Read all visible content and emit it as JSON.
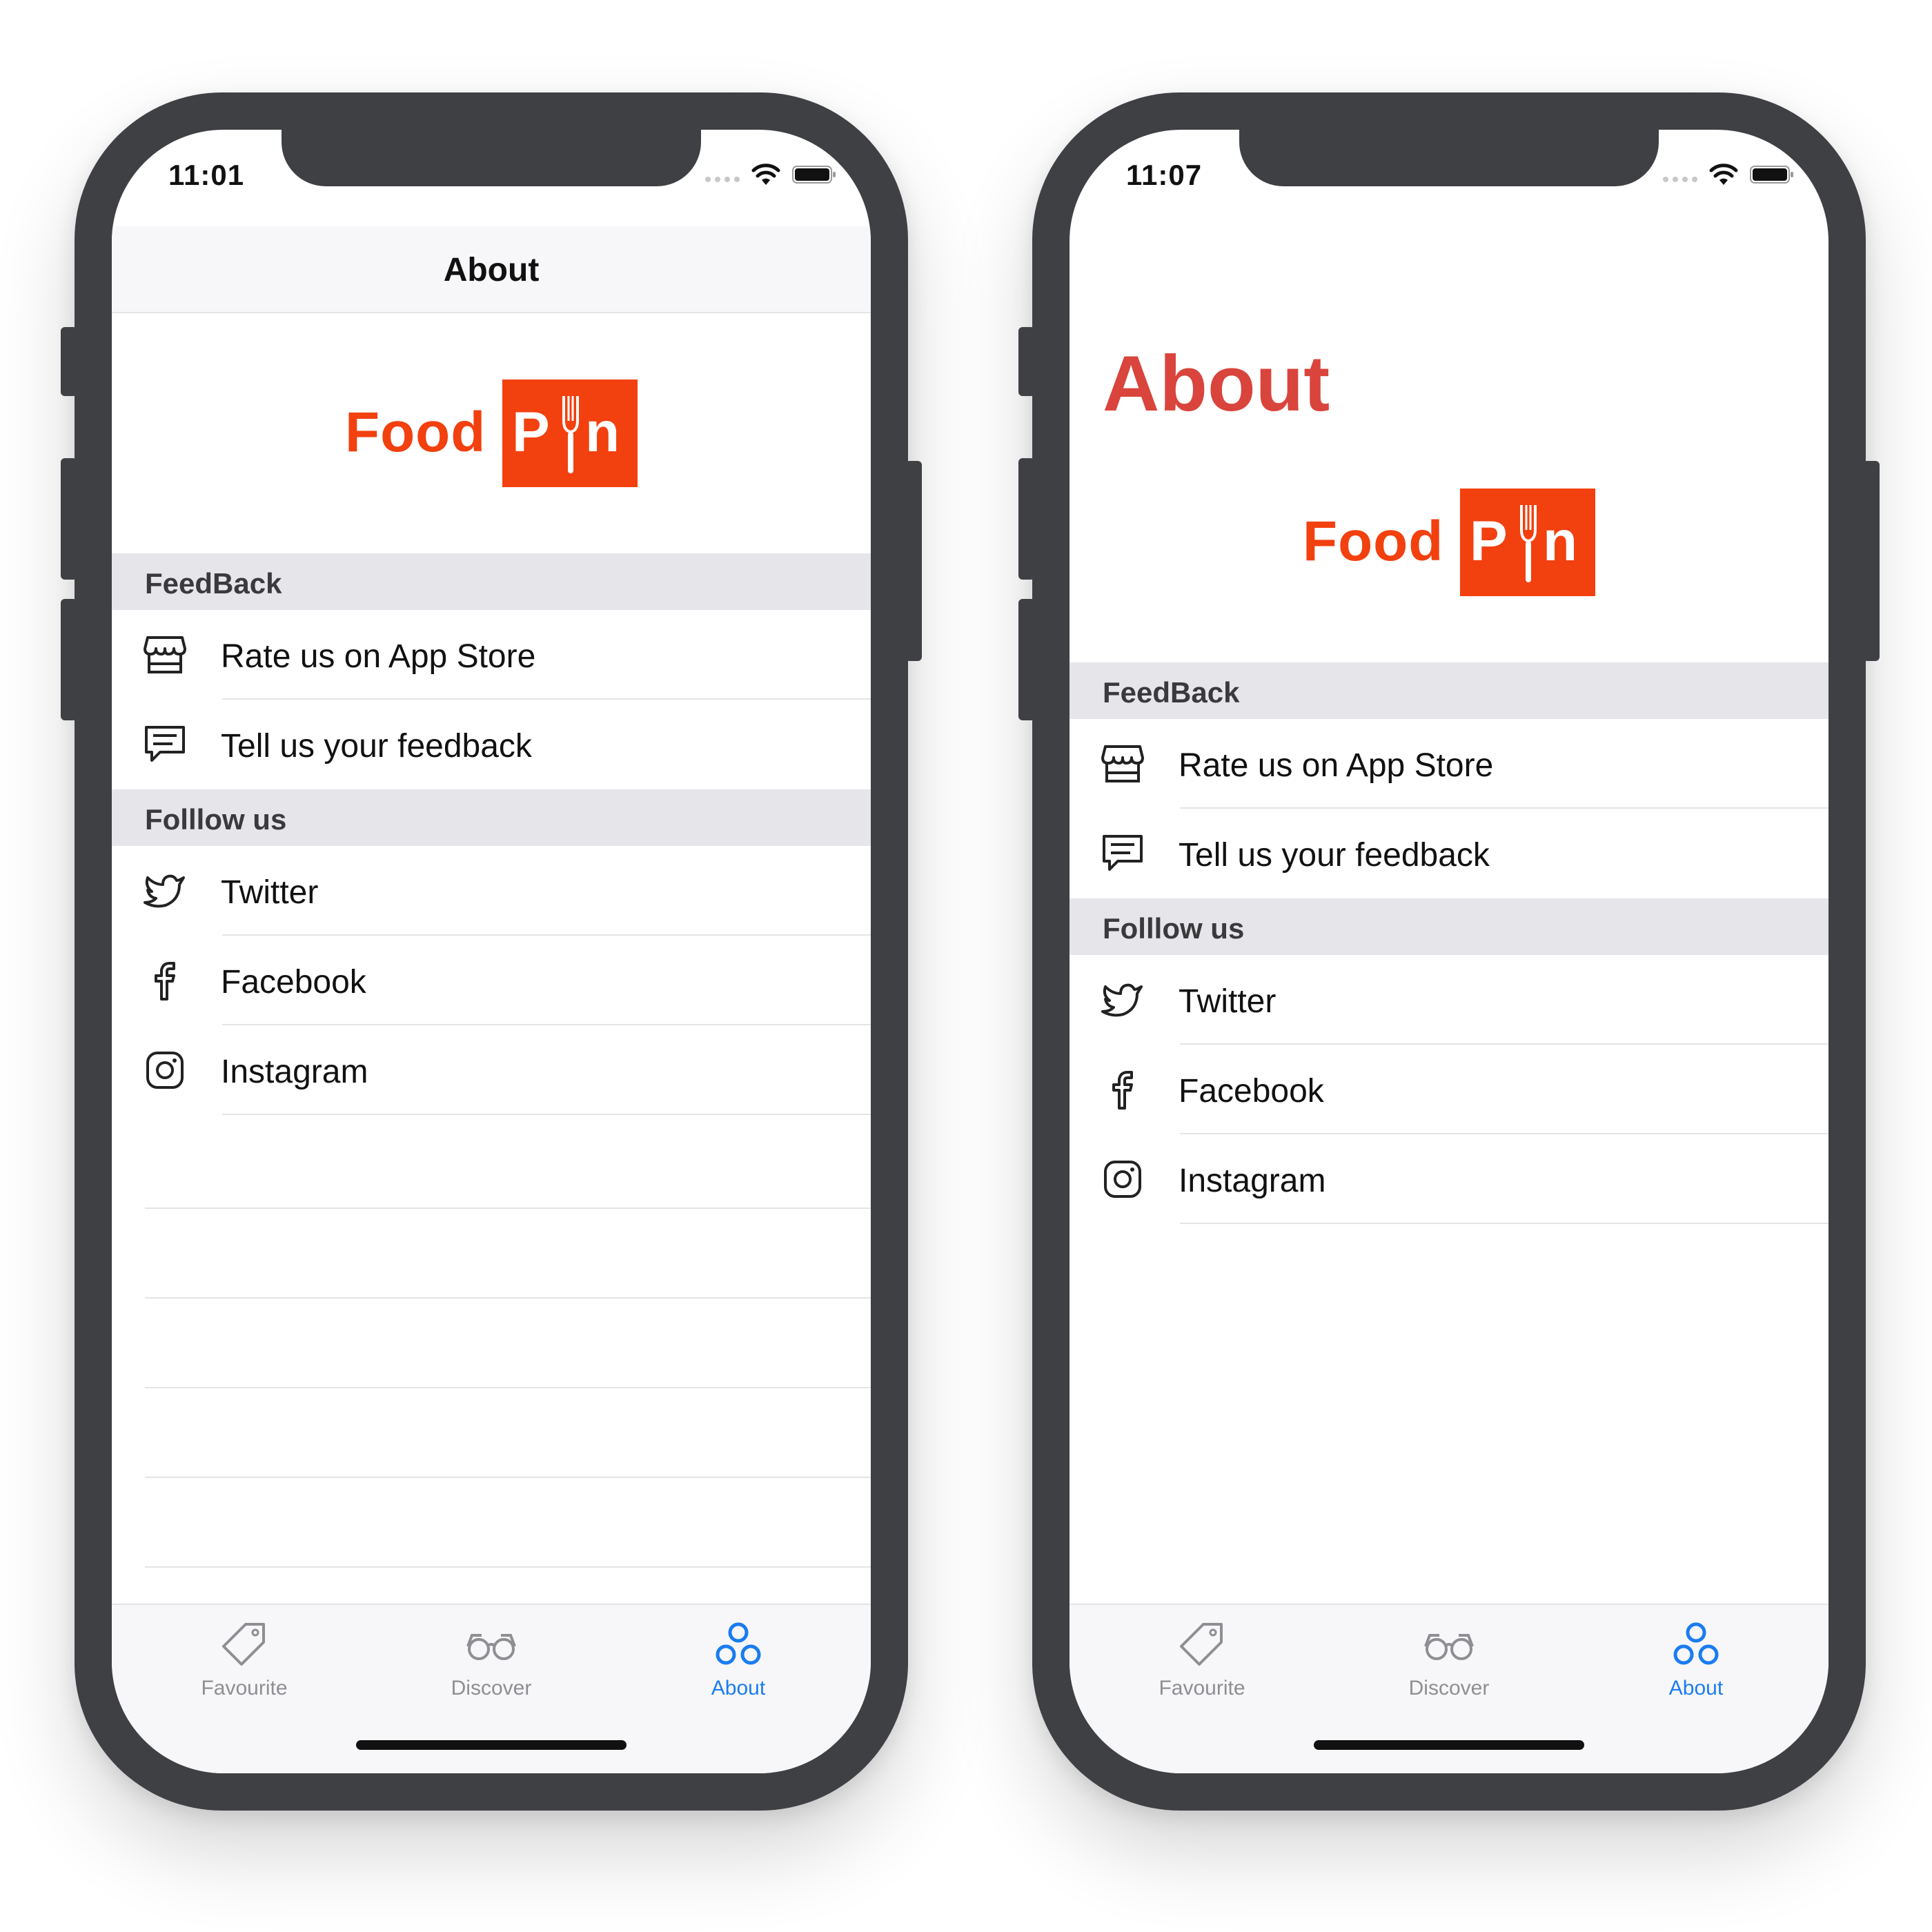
{
  "phones": [
    {
      "status_time": "11:01",
      "nav_title": "About",
      "large_title": "",
      "logo": {
        "food": "Food",
        "p": "P",
        "n": "n"
      },
      "sections": [
        {
          "header": "FeedBack",
          "rows": [
            {
              "icon": "store-icon",
              "label": "Rate us on App Store"
            },
            {
              "icon": "chat-icon",
              "label": "Tell us your feedback"
            }
          ]
        },
        {
          "header": "Folllow us",
          "rows": [
            {
              "icon": "twitter-icon",
              "label": "Twitter"
            },
            {
              "icon": "facebook-icon",
              "label": "Facebook"
            },
            {
              "icon": "instagram-icon",
              "label": "Instagram"
            }
          ]
        }
      ],
      "tabs": [
        {
          "icon": "tag-icon",
          "label": "Favourite",
          "active": false
        },
        {
          "icon": "glasses-icon",
          "label": "Discover",
          "active": false
        },
        {
          "icon": "circles-icon",
          "label": "About",
          "active": true
        }
      ]
    },
    {
      "status_time": "11:07",
      "nav_title": "",
      "large_title": "About",
      "logo": {
        "food": "Food",
        "p": "P",
        "n": "n"
      },
      "sections": [
        {
          "header": "FeedBack",
          "rows": [
            {
              "icon": "store-icon",
              "label": "Rate us on App Store"
            },
            {
              "icon": "chat-icon",
              "label": "Tell us your feedback"
            }
          ]
        },
        {
          "header": "Folllow us",
          "rows": [
            {
              "icon": "twitter-icon",
              "label": "Twitter"
            },
            {
              "icon": "facebook-icon",
              "label": "Facebook"
            },
            {
              "icon": "instagram-icon",
              "label": "Instagram"
            }
          ]
        }
      ],
      "tabs": [
        {
          "icon": "tag-icon",
          "label": "Favourite",
          "active": false
        },
        {
          "icon": "glasses-icon",
          "label": "Discover",
          "active": false
        },
        {
          "icon": "circles-icon",
          "label": "About",
          "active": true
        }
      ]
    }
  ],
  "colors": {
    "accent": "#1a7cf0",
    "brand": "#f2400f",
    "large_title": "#d9443c",
    "frame": "#3e4043"
  }
}
